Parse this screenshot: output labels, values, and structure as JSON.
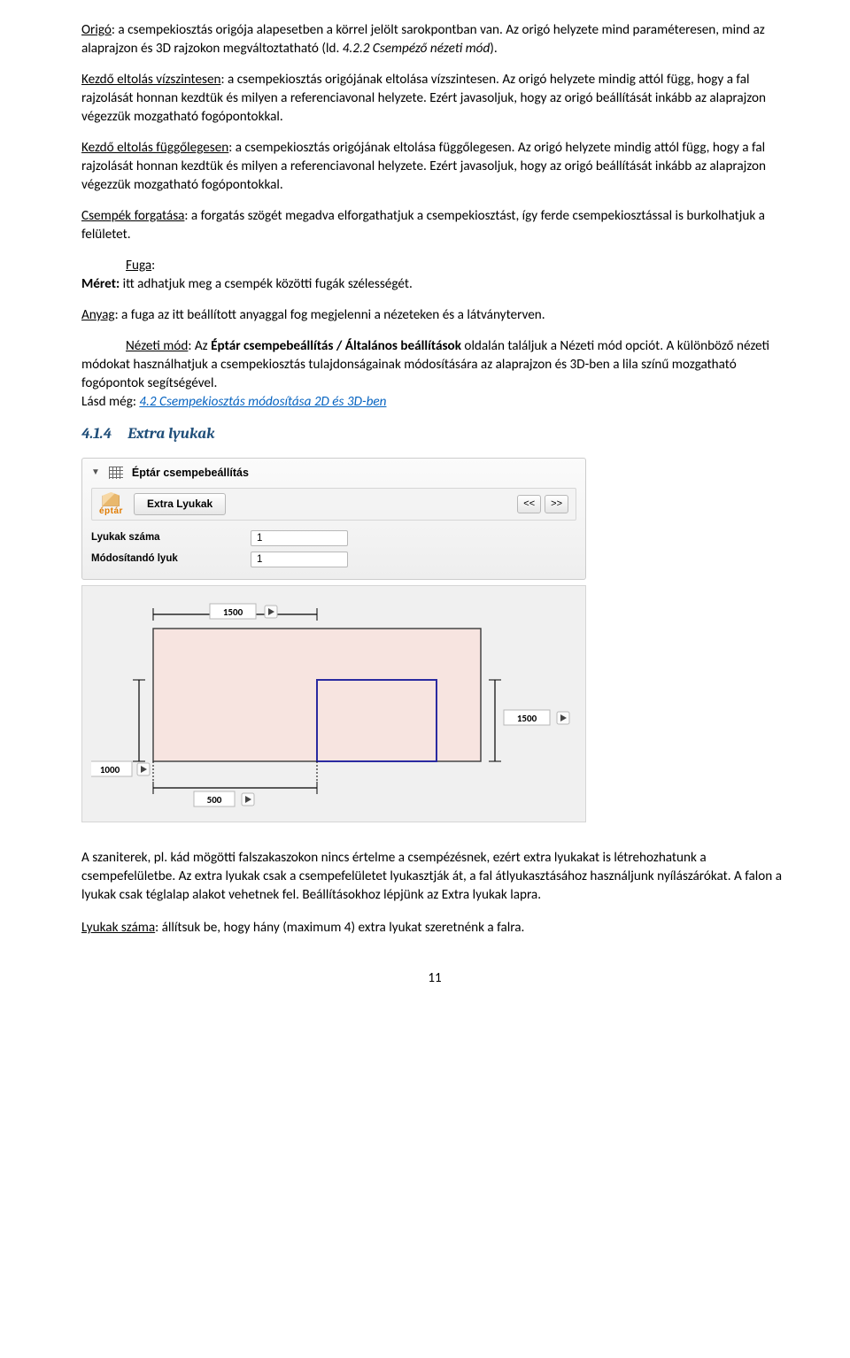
{
  "para_origo": {
    "u": "Origó",
    "rest": ": a csempekiosztás origója alapesetben a körrel jelölt sarokpontban van. Az origó helyzete mind paraméteresen, mind az alaprajzon és 3D rajzokon megváltoztatható (ld. ",
    "i": "4.2.2 Csempéző nézeti mód",
    "after": ")."
  },
  "para_kezdo_viz": {
    "u": "Kezdő eltolás vízszintesen",
    "rest": ": a csempekiosztás origójának eltolása vízszintesen. Az origó helyzete mindig attól függ, hogy a fal rajzolását honnan kezdtük és milyen a referenciavonal helyzete. Ezért javasoljuk, hogy az origó beállítását inkább az alaprajzon végezzük mozgatható fogópontokkal."
  },
  "para_kezdo_fug": {
    "u": "Kezdő eltolás függőlegesen",
    "rest": ": a csempekiosztás origójának eltolása függőlegesen. Az origó helyzete mindig attól függ, hogy a fal rajzolását honnan kezdtük és milyen a referenciavonal helyzete. Ezért javasoljuk, hogy az origó beállítását inkább az alaprajzon végezzük mozgatható fogópontokkal."
  },
  "para_forgatas": {
    "u": "Csempék forgatása",
    "rest": ": a forgatás szögét megadva elforgathatjuk a csempekiosztást, így ferde csempekiosztással is burkolhatjuk a felületet."
  },
  "para_fuga_head": "Fuga",
  "para_meret": {
    "b": "Méret:",
    "rest": " itt adhatjuk meg a csempék közötti fugák szélességét."
  },
  "para_anyag": {
    "u": "Anyag",
    "rest": ": a fuga az itt beállított anyaggal fog megjelenni a nézeteken és a látványterven."
  },
  "para_nezeti": {
    "u": "Nézeti mód",
    "before": ": Az ",
    "b": "Éptár csempebeállítás / Általános beállítások",
    "after": " oldalán találjuk a Nézeti mód opciót. A különböző nézeti módokat használhatjuk a csempekiosztás tulajdonságainak módosítására az alaprajzon és 3D-ben a lila színű mozgatható fogópontok segítségével."
  },
  "lasd_meg": {
    "txt": "Lásd még: ",
    "link": "4.2 Csempekiosztás módosítása 2D és 3D-ben"
  },
  "section": {
    "num": "4.1.4",
    "title": "Extra lyukak"
  },
  "panel": {
    "title": "Éptár csempebeállítás",
    "logo": "éptár",
    "tab": "Extra Lyukak",
    "prev": "<<",
    "next": ">>",
    "f1_lbl": "Lyukak száma",
    "f1_val": "1",
    "f2_lbl": "Módosítandó lyuk",
    "f2_val": "1"
  },
  "diagram": {
    "top_dim": "1500",
    "right_dim": "1500",
    "left_dim": "1000",
    "bottom_dim": "500"
  },
  "para_szaniter": "A szaniterek, pl. kád mögötti falszakaszokon nincs értelme a csempézésnek, ezért extra lyukakat is létrehozhatunk a csempefelületbe. Az extra lyukak csak a csempefelületet lyukasztják át, a fal átlyukasztásához használjunk nyílászárókat. A falon a lyukak csak téglalap alakot vehetnek fel. Beállításokhoz lépjünk az Extra lyukak lapra.",
  "para_lyukak_szama": {
    "u": "Lyukak száma",
    "rest": ": állítsuk be, hogy hány (maximum 4) extra lyukat szeretnénk a falra."
  },
  "page_number": "11"
}
